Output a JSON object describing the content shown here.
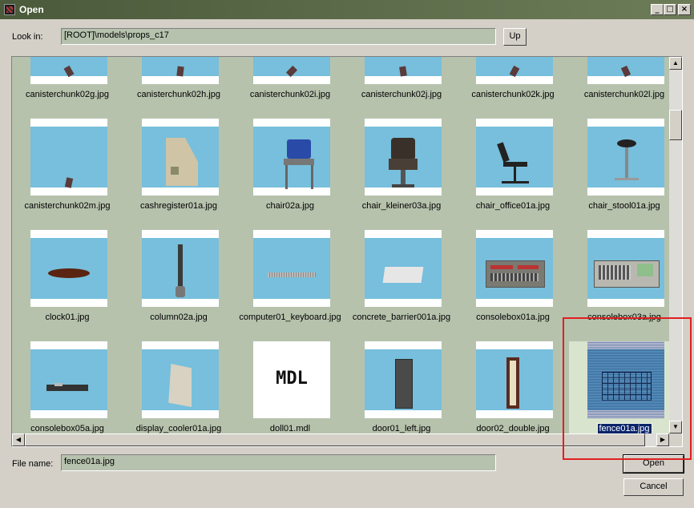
{
  "window": {
    "title": "Open",
    "buttons": {
      "minimize": "_",
      "maximize": "□",
      "close": "×"
    }
  },
  "look_in": {
    "label": "Look in:",
    "path": "[ROOT]\\models\\props_c17",
    "up_button": "Up"
  },
  "files": [
    {
      "name": "canisterchunk02g.jpg",
      "icon": "canister-chunk"
    },
    {
      "name": "canisterchunk02h.jpg",
      "icon": "canister-chunk"
    },
    {
      "name": "canisterchunk02i.jpg",
      "icon": "canister-chunk"
    },
    {
      "name": "canisterchunk02j.jpg",
      "icon": "canister-chunk"
    },
    {
      "name": "canisterchunk02k.jpg",
      "icon": "canister-chunk"
    },
    {
      "name": "canisterchunk02l.jpg",
      "icon": "canister-chunk"
    },
    {
      "name": "canisterchunk02m.jpg",
      "icon": "canister-chunk"
    },
    {
      "name": "cashregister01a.jpg",
      "icon": "cash-register"
    },
    {
      "name": "chair02a.jpg",
      "icon": "chair"
    },
    {
      "name": "chair_kleiner03a.jpg",
      "icon": "barber-chair"
    },
    {
      "name": "chair_office01a.jpg",
      "icon": "office-chair"
    },
    {
      "name": "chair_stool01a.jpg",
      "icon": "stool"
    },
    {
      "name": "clock01.jpg",
      "icon": "clock"
    },
    {
      "name": "column02a.jpg",
      "icon": "column"
    },
    {
      "name": "computer01_keyboard.jpg",
      "icon": "keyboard"
    },
    {
      "name": "concrete_barrier001a.jpg",
      "icon": "concrete-barrier"
    },
    {
      "name": "consolebox01a.jpg",
      "icon": "console-box"
    },
    {
      "name": "consolebox03a.jpg",
      "icon": "console-box-screen"
    },
    {
      "name": "consolebox05a.jpg",
      "icon": "console-box-small"
    },
    {
      "name": "display_cooler01a.jpg",
      "icon": "display-cooler"
    },
    {
      "name": "doll01.mdl",
      "icon": "mdl",
      "label": "MDL"
    },
    {
      "name": "door01_left.jpg",
      "icon": "door"
    },
    {
      "name": "door02_double.jpg",
      "icon": "door-narrow"
    },
    {
      "name": "fence01a.jpg",
      "icon": "fence",
      "selected": true
    }
  ],
  "file_name": {
    "label": "File name:",
    "value": "fence01a.jpg"
  },
  "actions": {
    "open": "Open",
    "cancel": "Cancel"
  },
  "colors": {
    "titlebar": "#4a5a3a",
    "thumb_sky": "#77bfdc",
    "browser_bg": "#b7c2ad",
    "selection": "#0a246a",
    "annotation_box": "#e02020"
  }
}
